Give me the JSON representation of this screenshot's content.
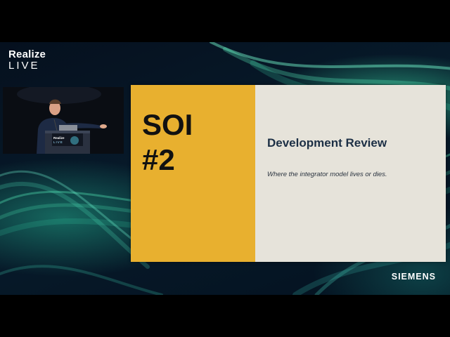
{
  "brand": {
    "line1": "Realize",
    "line2": "LIVE"
  },
  "slide": {
    "soi": "SOI",
    "number": "#2",
    "heading": "Development Review",
    "subtitle": "Where the integrator model lives or dies."
  },
  "podium": {
    "line1": "Realize",
    "line2": "LIVE"
  },
  "footer": {
    "logo": "SIEMENS"
  },
  "colors": {
    "slide_accent": "#e8b02f",
    "slide_panel": "#e6e3da",
    "heading": "#1c2f45"
  }
}
